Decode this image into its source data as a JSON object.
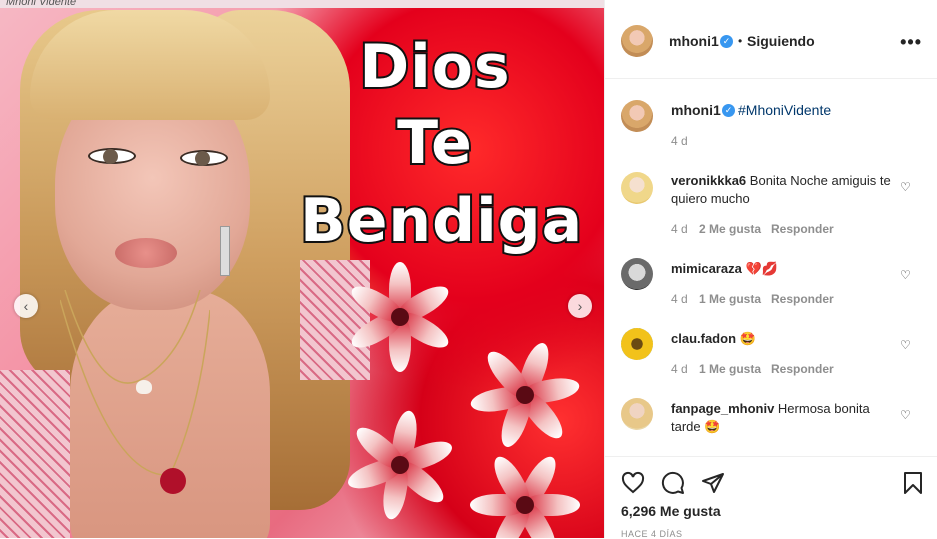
{
  "post": {
    "image_text": [
      "Dios",
      "Te",
      "Bendiga"
    ],
    "top_strip_text": "Mhoni Vidente"
  },
  "header": {
    "username": "mhoni1",
    "separator": "•",
    "follow_status": "Siguiendo",
    "more": "•••"
  },
  "caption": {
    "username": "mhoni1",
    "hashtag": "#MhoniVidente",
    "time": "4 d"
  },
  "comments": [
    {
      "username": "veronikkka6",
      "text": "Bonita Noche amiguis te quiero mucho",
      "time": "4 d",
      "likes": "2 Me gusta",
      "reply": "Responder"
    },
    {
      "username": "mimicaraza",
      "text": "💔💋",
      "time": "4 d",
      "likes": "1 Me gusta",
      "reply": "Responder"
    },
    {
      "username": "clau.fadon",
      "text": "🤩",
      "time": "4 d",
      "likes": "1 Me gusta",
      "reply": "Responder"
    },
    {
      "username": "fanpage_mhoniv",
      "text": "Hermosa bonita tarde 🤩",
      "time": "",
      "likes": "",
      "reply": ""
    }
  ],
  "footer": {
    "likes": "6,296 Me gusta",
    "ago": "HACE 4 DÍAS"
  },
  "icons": {
    "like": "heart-icon",
    "comment": "comment-icon",
    "share": "send-icon",
    "save": "bookmark-icon",
    "prev": "chevron-left-icon",
    "next": "chevron-right-icon",
    "verified": "verified-badge-icon"
  },
  "colors": {
    "verified": "#3897f0",
    "hashtag": "#00376b",
    "muted": "#8e8e8e"
  }
}
